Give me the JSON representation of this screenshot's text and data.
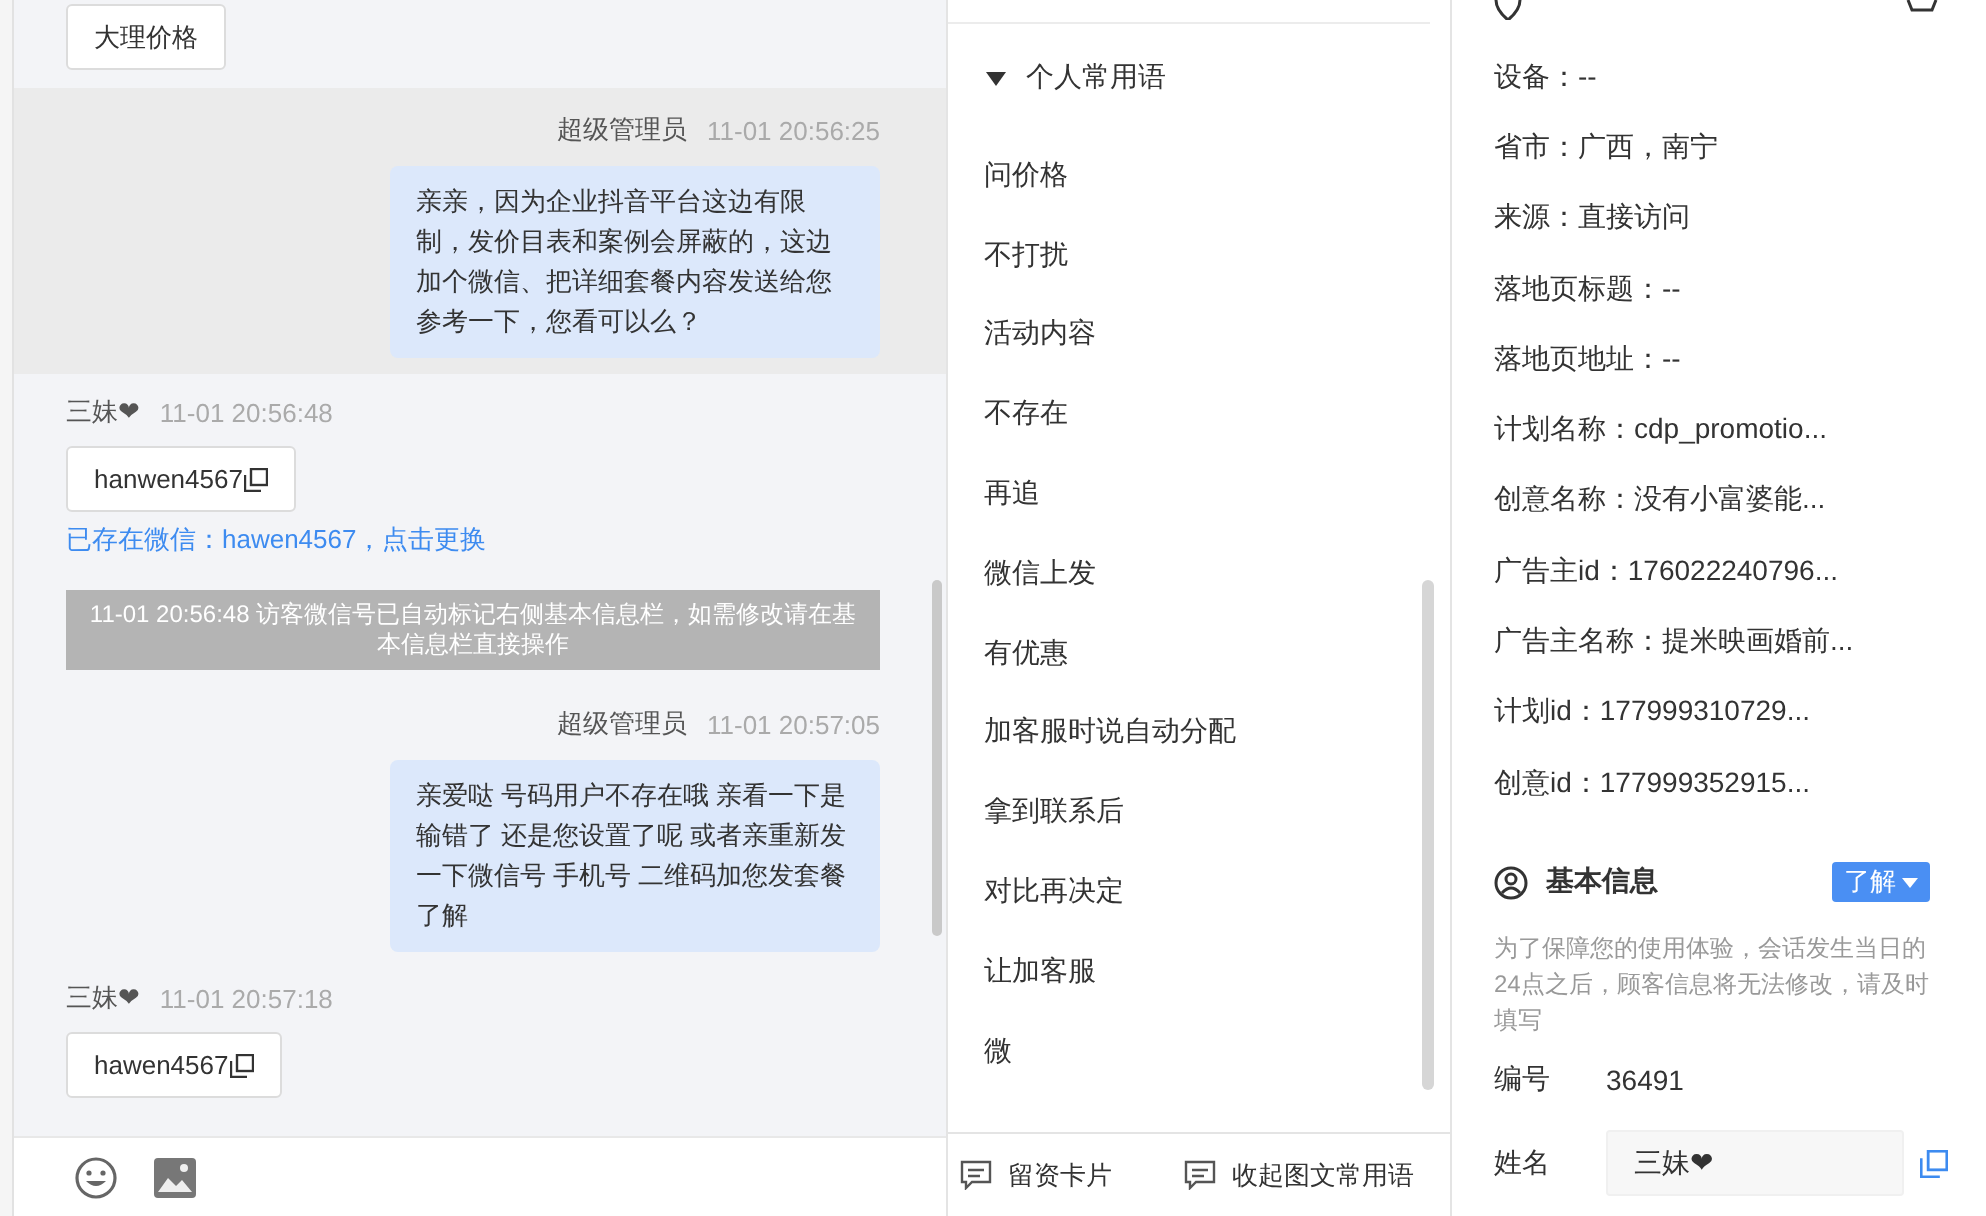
{
  "chat": {
    "messages": [
      {
        "kind": "card",
        "text": "大理价格"
      },
      {
        "kind": "agent",
        "highlighted": true,
        "sender": "超级管理员",
        "time": "11-01 20:56:25",
        "text": "亲亲，因为企业抖音平台这边有限制，发价目表和案例会屏蔽的，这边加个微信、把详细套餐内容发送给您参考一下，您看可以么？"
      },
      {
        "kind": "visitor",
        "sender": "三妹❤",
        "time": "11-01 20:56:48",
        "card": "hanwen4567",
        "link": "已存在微信：hawen4567，点击更换"
      },
      {
        "kind": "notice",
        "text": "11-01 20:56:48 访客微信号已自动标记右侧基本信息栏，如需修改请在基本信息栏直接操作"
      },
      {
        "kind": "agent",
        "highlighted": false,
        "sender": "超级管理员",
        "time": "11-01 20:57:05",
        "text": "亲爱哒 号码用户不存在哦 亲看一下是输错了 还是您设置了呢 或者亲重新发一下微信号 手机号 二维码加您发套餐了解"
      },
      {
        "kind": "visitor",
        "sender": "三妹❤",
        "time": "11-01 20:57:18",
        "card": "hawen4567"
      }
    ]
  },
  "phrases": {
    "group": {
      "label": "个人常用语",
      "expanded": true
    },
    "items": [
      "问价格",
      "不打扰",
      "活动内容",
      "不存在",
      "再追",
      "微信上发",
      "有优惠",
      "加客服时说自动分配",
      "拿到联系后",
      "对比再决定",
      "让加客服",
      "微"
    ],
    "actions": [
      "留资卡片",
      "收起图文常用语"
    ]
  },
  "source_info": {
    "fields": [
      "设备：--",
      "省市：广西，南宁",
      "来源：直接访问",
      "落地页标题：--",
      "落地页地址：--",
      "计划名称：cdp_promotio...",
      "创意名称：没有小富婆能...",
      "广告主id：176022240796...",
      "广告主名称：提米映画婚前...",
      "计划id：177999310729...",
      "创意id：177999352915..."
    ]
  },
  "basic_info": {
    "title": "基本信息",
    "button": "了解",
    "note": "为了保障您的使用体验，会话发生当日的24点之后，顾客信息将无法修改，请及时填写",
    "fields": [
      {
        "kind": "text",
        "label": "编号",
        "value": "36491"
      },
      {
        "kind": "input",
        "label": "姓名",
        "value": "三妹❤"
      }
    ]
  }
}
